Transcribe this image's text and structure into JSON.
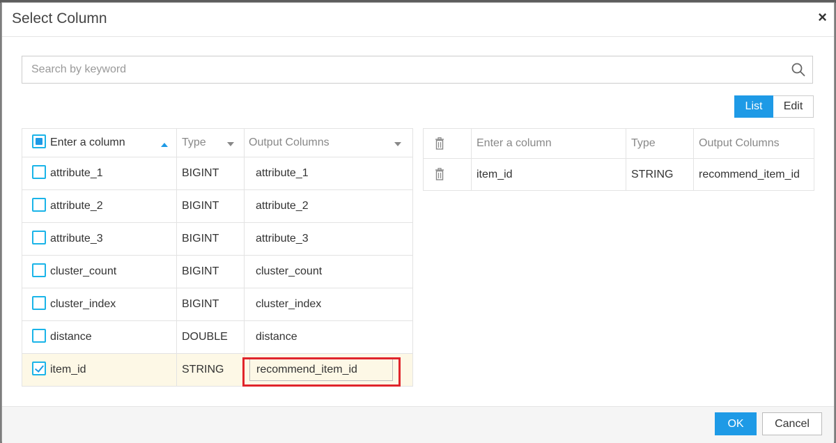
{
  "dialog": {
    "title": "Select Column",
    "close_symbol": "×"
  },
  "search": {
    "placeholder": "Search by keyword",
    "value": ""
  },
  "view_toggle": {
    "list_label": "List",
    "edit_label": "Edit",
    "active": "List"
  },
  "left_table": {
    "headers": {
      "column": "Enter a column",
      "type": "Type",
      "output": "Output Columns"
    },
    "header_checkbox_state": "partial",
    "rows": [
      {
        "name": "attribute_1",
        "type": "BIGINT",
        "output": "attribute_1",
        "checked": false
      },
      {
        "name": "attribute_2",
        "type": "BIGINT",
        "output": "attribute_2",
        "checked": false
      },
      {
        "name": "attribute_3",
        "type": "BIGINT",
        "output": "attribute_3",
        "checked": false
      },
      {
        "name": "cluster_count",
        "type": "BIGINT",
        "output": "cluster_count",
        "checked": false
      },
      {
        "name": "cluster_index",
        "type": "BIGINT",
        "output": "cluster_index",
        "checked": false
      },
      {
        "name": "distance",
        "type": "DOUBLE",
        "output": "distance",
        "checked": false
      },
      {
        "name": "item_id",
        "type": "STRING",
        "output": "recommend_item_id",
        "checked": true
      }
    ]
  },
  "right_table": {
    "headers": {
      "column": "Enter a column",
      "type": "Type",
      "output": "Output Columns"
    },
    "rows": [
      {
        "name": "item_id",
        "type": "STRING",
        "output": "recommend_item_id"
      }
    ]
  },
  "footer": {
    "ok_label": "OK",
    "cancel_label": "Cancel"
  },
  "colors": {
    "accent": "#1e9ae6",
    "checkbox_border": "#1ab4e8",
    "selected_row_bg": "#fdf8e6",
    "highlight_border": "#e0242b"
  },
  "icons": {
    "search": "search-icon",
    "delete": "trash-icon",
    "close": "close-icon"
  }
}
